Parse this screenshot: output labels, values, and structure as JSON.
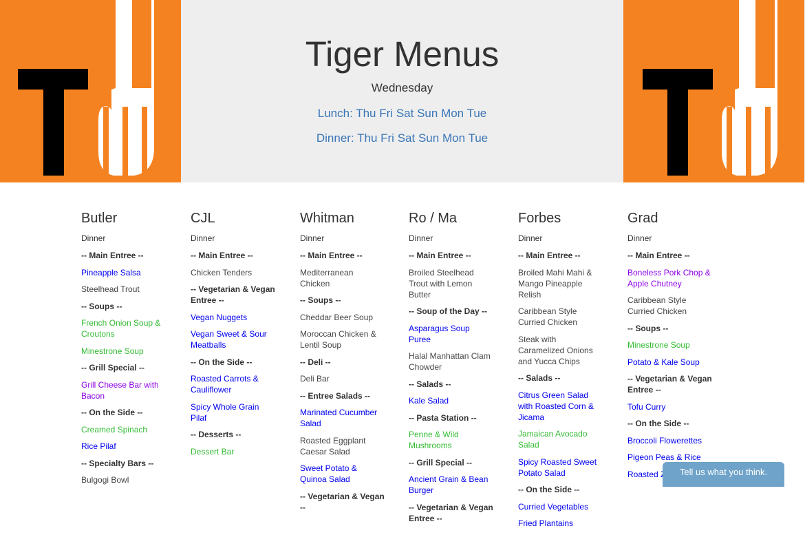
{
  "header": {
    "title": "Tiger Menus",
    "day": "Wednesday",
    "lunch_label": "Lunch:",
    "lunch_days": [
      "Thu",
      "Fri",
      "Sat",
      "Sun",
      "Mon",
      "Tue"
    ],
    "dinner_label": "Dinner:",
    "dinner_days": [
      "Thu",
      "Fri",
      "Sat",
      "Sun",
      "Mon",
      "Tue"
    ],
    "logo_icon": "tiger-menus-fork-logo-icon",
    "logo_color": "#f58220",
    "link_color": "#3a76b7"
  },
  "halls": [
    {
      "name": "Butler",
      "meal": "Dinner",
      "items": [
        {
          "text": "-- Main Entree --",
          "type": "heading"
        },
        {
          "text": "Pineapple Salsa",
          "type": "blue"
        },
        {
          "text": "Steelhead Trout",
          "type": "plain"
        },
        {
          "text": "-- Soups --",
          "type": "heading"
        },
        {
          "text": "French Onion Soup & Croutons",
          "type": "green"
        },
        {
          "text": "Minestrone Soup",
          "type": "green"
        },
        {
          "text": "-- Grill Special --",
          "type": "heading"
        },
        {
          "text": "Grill Cheese Bar with Bacon",
          "type": "purple"
        },
        {
          "text": "-- On the Side --",
          "type": "heading"
        },
        {
          "text": "Creamed Spinach",
          "type": "green"
        },
        {
          "text": "Rice Pilaf",
          "type": "blue"
        },
        {
          "text": "-- Specialty Bars --",
          "type": "heading"
        },
        {
          "text": "Bulgogi Bowl",
          "type": "plain"
        }
      ]
    },
    {
      "name": "CJL",
      "meal": "Dinner",
      "items": [
        {
          "text": "-- Main Entree --",
          "type": "heading"
        },
        {
          "text": "Chicken Tenders",
          "type": "plain"
        },
        {
          "text": "-- Vegetarian & Vegan Entree --",
          "type": "heading"
        },
        {
          "text": "Vegan Nuggets",
          "type": "blue"
        },
        {
          "text": "Vegan Sweet & Sour Meatballs",
          "type": "blue"
        },
        {
          "text": "-- On the Side --",
          "type": "heading"
        },
        {
          "text": "Roasted Carrots & Cauliflower",
          "type": "blue"
        },
        {
          "text": "Spicy Whole Grain Pilaf",
          "type": "blue"
        },
        {
          "text": "-- Desserts --",
          "type": "heading"
        },
        {
          "text": "Dessert Bar",
          "type": "green"
        }
      ]
    },
    {
      "name": "Whitman",
      "meal": "Dinner",
      "items": [
        {
          "text": "-- Main Entree --",
          "type": "heading"
        },
        {
          "text": "Mediterranean Chicken",
          "type": "plain"
        },
        {
          "text": "-- Soups --",
          "type": "heading"
        },
        {
          "text": "Cheddar Beer Soup",
          "type": "plain"
        },
        {
          "text": "Moroccan Chicken & Lentil Soup",
          "type": "plain"
        },
        {
          "text": "-- Deli --",
          "type": "heading"
        },
        {
          "text": "Deli Bar",
          "type": "plain"
        },
        {
          "text": "-- Entree Salads --",
          "type": "heading"
        },
        {
          "text": "Marinated Cucumber Salad",
          "type": "blue"
        },
        {
          "text": "Roasted Eggplant Caesar Salad",
          "type": "plain"
        },
        {
          "text": "Sweet Potato & Quinoa Salad",
          "type": "blue"
        },
        {
          "text": "-- Vegetarian & Vegan --",
          "type": "heading"
        }
      ]
    },
    {
      "name": "Ro / Ma",
      "meal": "Dinner",
      "items": [
        {
          "text": "-- Main Entree --",
          "type": "heading"
        },
        {
          "text": "Broiled Steelhead Trout with Lemon Butter",
          "type": "plain"
        },
        {
          "text": "-- Soup of the Day --",
          "type": "heading"
        },
        {
          "text": "Asparagus Soup Puree",
          "type": "blue"
        },
        {
          "text": "Halal Manhattan Clam Chowder",
          "type": "plain"
        },
        {
          "text": "-- Salads --",
          "type": "heading"
        },
        {
          "text": "Kale Salad",
          "type": "blue"
        },
        {
          "text": "-- Pasta Station --",
          "type": "heading"
        },
        {
          "text": "Penne & Wild Mushrooms",
          "type": "green"
        },
        {
          "text": "-- Grill Special --",
          "type": "heading"
        },
        {
          "text": "Ancient Grain & Bean Burger",
          "type": "blue"
        },
        {
          "text": "-- Vegetarian & Vegan Entree --",
          "type": "heading"
        }
      ]
    },
    {
      "name": "Forbes",
      "meal": "Dinner",
      "items": [
        {
          "text": "-- Main Entree --",
          "type": "heading"
        },
        {
          "text": "Broiled Mahi Mahi & Mango Pineapple Relish",
          "type": "plain"
        },
        {
          "text": "Caribbean Style Curried Chicken",
          "type": "plain"
        },
        {
          "text": "Steak with Caramelized Onions and Yucca Chips",
          "type": "plain"
        },
        {
          "text": "-- Salads --",
          "type": "heading"
        },
        {
          "text": "Citrus Green Salad with Roasted Corn & Jicama",
          "type": "blue"
        },
        {
          "text": "Jamaican Avocado Salad",
          "type": "green"
        },
        {
          "text": "Spicy Roasted Sweet Potato Salad",
          "type": "blue"
        },
        {
          "text": "-- On the Side --",
          "type": "heading"
        },
        {
          "text": "Curried Vegetables",
          "type": "blue"
        },
        {
          "text": "Fried Plantains",
          "type": "blue"
        }
      ]
    },
    {
      "name": "Grad",
      "meal": "Dinner",
      "items": [
        {
          "text": "-- Main Entree --",
          "type": "heading"
        },
        {
          "text": "Boneless Pork Chop & Apple Chutney",
          "type": "purple"
        },
        {
          "text": "Caribbean Style Curried Chicken",
          "type": "plain"
        },
        {
          "text": "-- Soups --",
          "type": "heading"
        },
        {
          "text": "Minestrone Soup",
          "type": "green"
        },
        {
          "text": "Potato & Kale Soup",
          "type": "blue"
        },
        {
          "text": "-- Vegetarian & Vegan Entree --",
          "type": "heading"
        },
        {
          "text": "Tofu Curry",
          "type": "blue"
        },
        {
          "text": "-- On the Side --",
          "type": "heading"
        },
        {
          "text": "Broccoli Flowerettes",
          "type": "blue"
        },
        {
          "text": "Pigeon Peas & Rice",
          "type": "blue"
        },
        {
          "text": "Roasted Z",
          "type": "blue"
        }
      ]
    }
  ],
  "feedback": {
    "label": "Tell us what you think."
  },
  "colors": {
    "vegan": "#33bb33",
    "vegetarian": "#0000ee",
    "pork": "#8b00e6"
  }
}
